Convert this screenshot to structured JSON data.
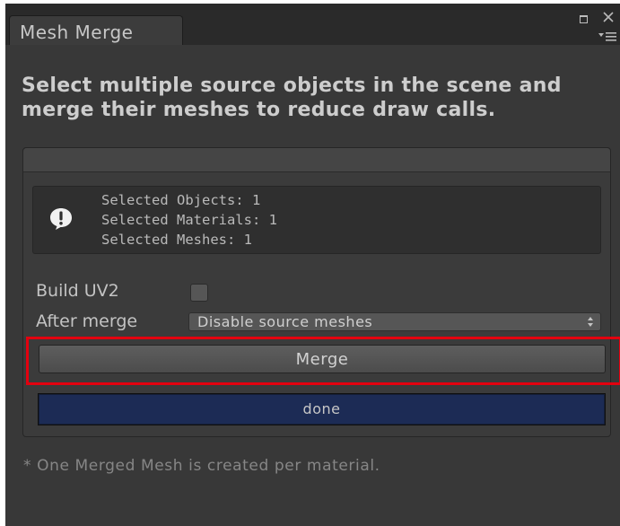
{
  "window": {
    "tab_title": "Mesh Merge"
  },
  "headline": {
    "line1": "Select multiple source objects in the scene and",
    "line2": "merge their meshes to reduce draw calls."
  },
  "info": {
    "lines": [
      "Selected Objects: 1",
      "Selected Materials: 1",
      "Selected Meshes: 1"
    ],
    "icon": "info-exclamation-icon"
  },
  "options": {
    "build_uv2_label": "Build UV2",
    "build_uv2_checked": false,
    "after_merge_label": "After merge",
    "after_merge_value": "Disable source meshes"
  },
  "merge_button_label": "Merge",
  "progress": {
    "label": "done",
    "fraction": 1.0
  },
  "footnote": "* One Merged Mesh is created per material.",
  "colors": {
    "highlight": "#e3000f",
    "progress_fill": "#1c2b55",
    "window_bg": "#383838"
  }
}
